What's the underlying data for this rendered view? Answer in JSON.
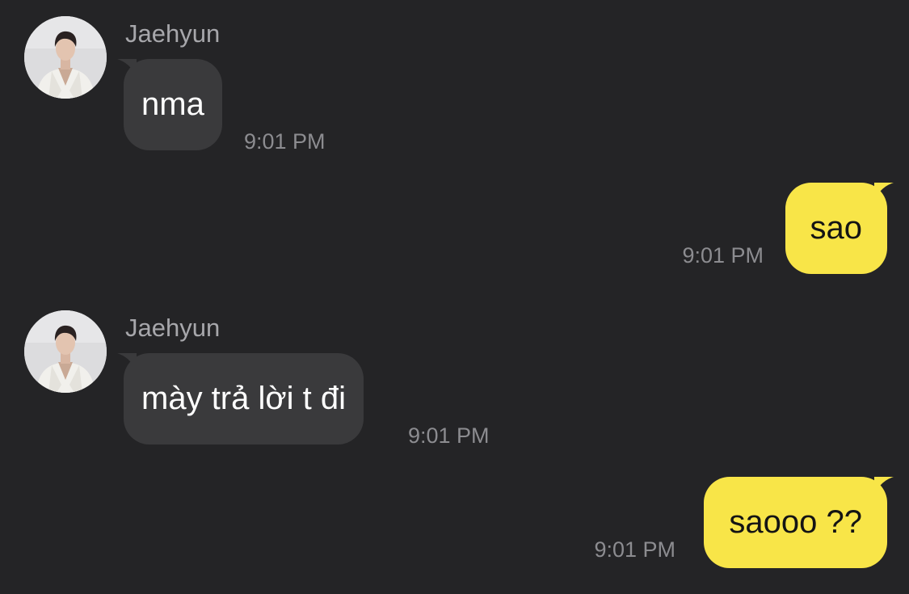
{
  "chat": {
    "messages": [
      {
        "direction": "incoming",
        "sender": "Jaehyun",
        "text": "nma",
        "time": "9:01 PM",
        "avatar_icon": "profile-photo-icon"
      },
      {
        "direction": "outgoing",
        "text": "sao",
        "time": "9:01 PM"
      },
      {
        "direction": "incoming",
        "sender": "Jaehyun",
        "text": "mày trả lời t đi",
        "time": "9:01 PM",
        "avatar_icon": "profile-photo-icon"
      },
      {
        "direction": "outgoing",
        "text": "saooo ??",
        "time": "9:01 PM"
      }
    ]
  },
  "colors": {
    "background": "#242426",
    "incoming_bubble": "#3a3a3c",
    "outgoing_bubble": "#f8e548",
    "sender_name": "#a7a7ab",
    "timestamp": "#8c8c90"
  }
}
